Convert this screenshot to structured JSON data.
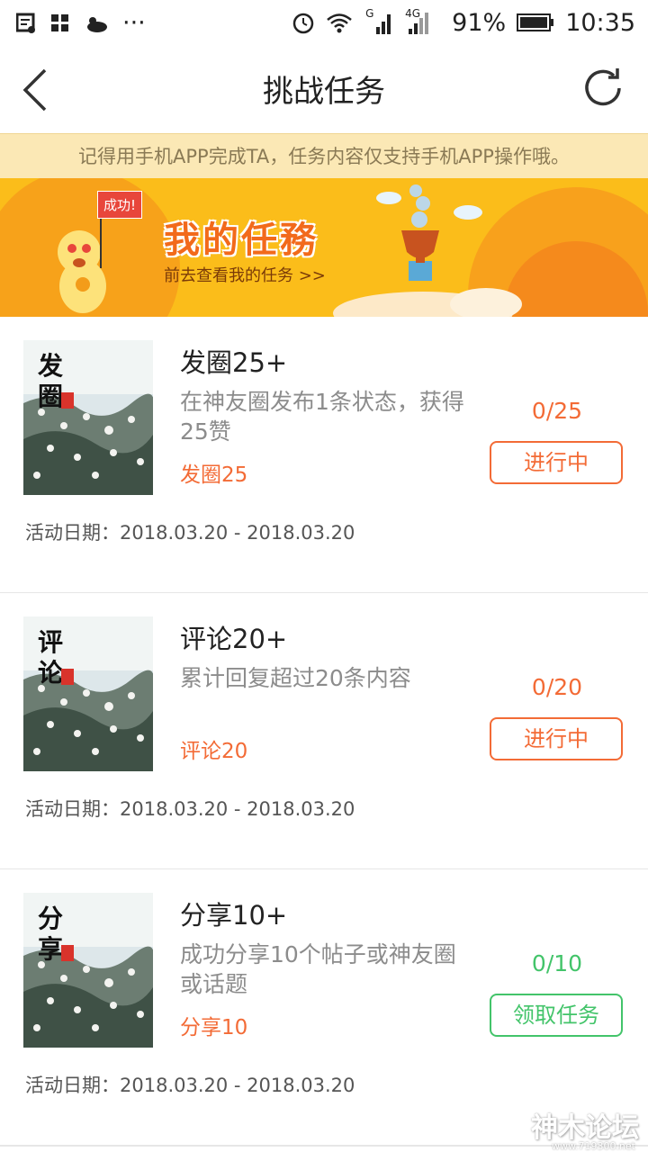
{
  "status_bar": {
    "battery": "91%",
    "time": "10:35",
    "net_1": "G",
    "net_2": "4G"
  },
  "header": {
    "title": "挑战任务"
  },
  "notice": "记得用手机APP完成TA，任务内容仅支持手机APP操作哦。",
  "banner": {
    "title": "我的任務",
    "subtitle": "前去查看我的任务 >>",
    "flag": "成功!"
  },
  "tasks": [
    {
      "thumb_text": "发圈",
      "name": "发圈25+",
      "desc": "在神友圈发布1条状态，获得25赞",
      "tag": "发圈25",
      "progress": "0/25",
      "button": "进行中",
      "date": "活动日期：2018.03.20 - 2018.03.20"
    },
    {
      "thumb_text": "评论",
      "name": "评论20+",
      "desc": "累计回复超过20条内容",
      "tag": "评论20",
      "progress": "0/20",
      "button": "进行中",
      "date": "活动日期：2018.03.20 - 2018.03.20"
    },
    {
      "thumb_text": "分享",
      "name": "分享10+",
      "desc": "成功分享10个帖子或神友圈或话题",
      "tag": "分享10",
      "progress": "0/10",
      "button": "领取任务",
      "date": "活动日期：2018.03.20 - 2018.03.20"
    }
  ],
  "colors": {
    "accent_orange": "#f36b36",
    "accent_green": "#43c46a",
    "notice_bg": "#fbe8b5"
  },
  "watermark": "神木论坛",
  "watermark_url": "www.719300.net"
}
